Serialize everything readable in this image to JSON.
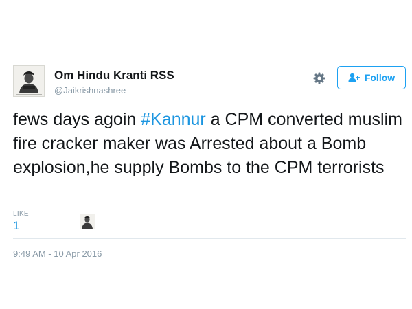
{
  "user": {
    "name": "Om Hindu Kranti RSS",
    "handle": "@Jaikrishnashree",
    "avatar_icon": "profile-photo-icon"
  },
  "follow_button": {
    "label": "Follow",
    "icon": "add-user-icon",
    "color": "#1da1f2"
  },
  "settings_icon": "gear-icon",
  "tweet": {
    "text_before_hashtag": "fews days agoin ",
    "hashtag": "#Kannur",
    "text_after_hashtag": " a CPM converted muslim fire cracker maker was Arrested  about a Bomb explosion,he supply Bombs to the CPM terrorists",
    "hashtag_color": "#1b95e0"
  },
  "stats": {
    "like_label": "LIKE",
    "like_count": "1"
  },
  "timestamp": "9:49 AM - 10 Apr 2016"
}
